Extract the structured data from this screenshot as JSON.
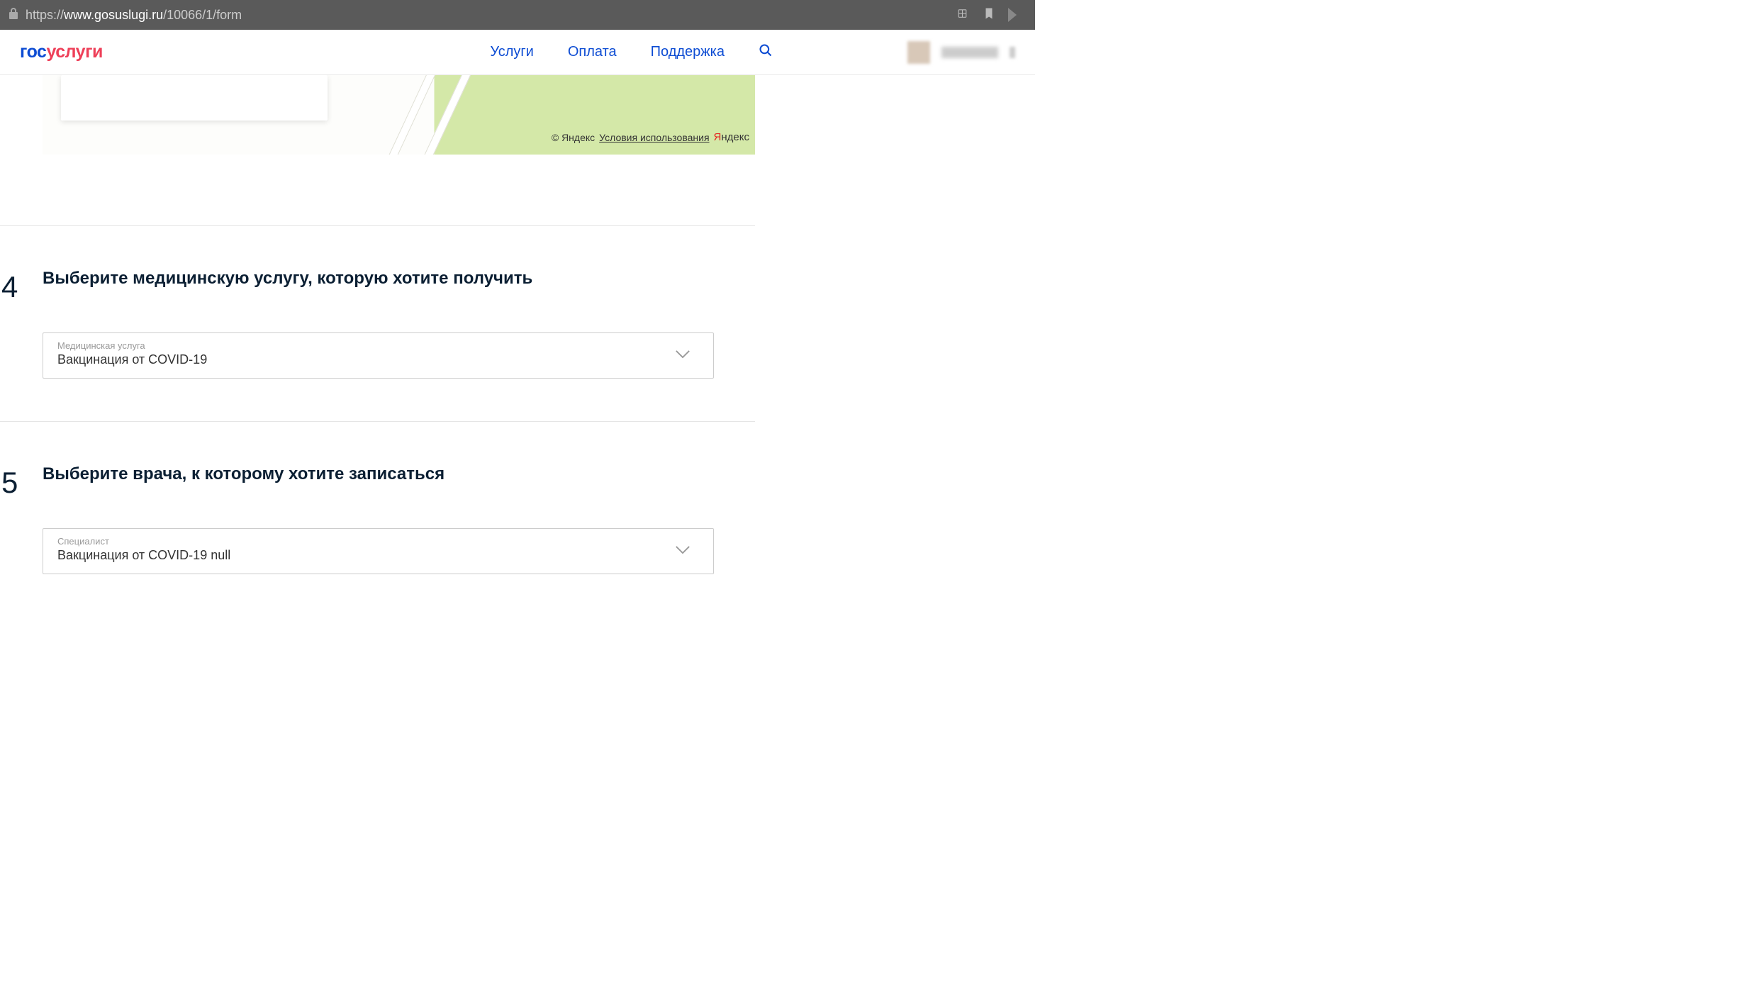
{
  "browser": {
    "url_prefix": "https://",
    "url_domain": "www.gosuslugi.ru",
    "url_path": "/10066/1/form"
  },
  "header": {
    "logo_part1": "гос",
    "logo_part2": "услуги",
    "nav": {
      "services": "Услуги",
      "payment": "Оплата",
      "support": "Поддержка"
    }
  },
  "map": {
    "copyright": "© Яндекс",
    "terms": "Условия использования",
    "yandex_y": "Я",
    "yandex_rest": "ндекс"
  },
  "step4": {
    "number": "4",
    "title": "Выберите медицинскую услугу, которую хотите получить",
    "select_label": "Медицинская услуга",
    "select_value": "Вакцинация от COVID-19"
  },
  "step5": {
    "number": "5",
    "title": "Выберите врача, к которому хотите записаться",
    "select_label": "Специалист",
    "select_value": "Вакцинация от COVID-19 null"
  }
}
